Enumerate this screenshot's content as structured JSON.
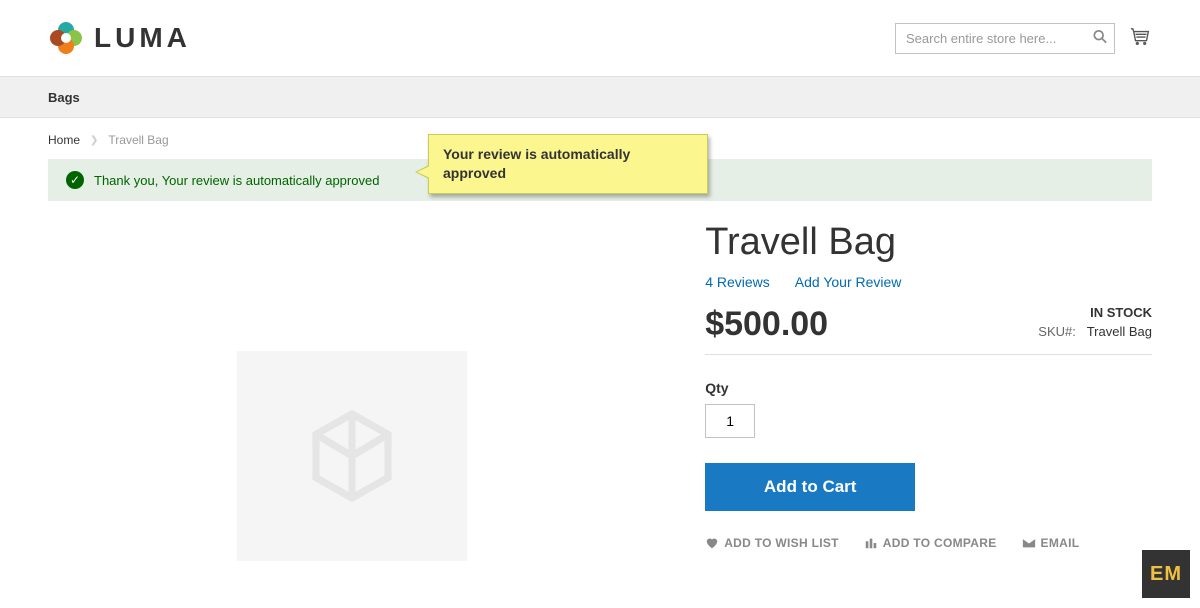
{
  "header": {
    "logo_text": "LUMA",
    "search_placeholder": "Search entire store here..."
  },
  "nav": {
    "item": "Bags"
  },
  "breadcrumb": {
    "home": "Home",
    "current": "Travell Bag"
  },
  "message": {
    "text": "Thank you, Your review is automatically approved",
    "tooltip": "Your review is automatically approved"
  },
  "product": {
    "title": "Travell Bag",
    "reviews_link": "4 Reviews",
    "add_review_link": "Add Your Review",
    "price": "$500.00",
    "stock_status": "IN STOCK",
    "sku_label": "SKU#:",
    "sku_value": "Travell Bag",
    "qty_label": "Qty",
    "qty_value": "1",
    "add_to_cart": "Add to Cart",
    "wishlist": "ADD TO WISH LIST",
    "compare": "ADD TO COMPARE",
    "email": "EMAIL"
  },
  "badge": {
    "text": "EM"
  }
}
